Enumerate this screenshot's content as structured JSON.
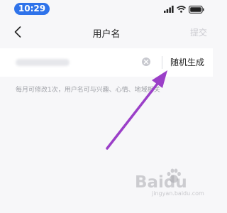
{
  "status_bar": {
    "time": "10:29",
    "icons": [
      "signal-icon",
      "wifi-icon",
      "battery-icon"
    ],
    "time_pill_color": "#2f73ea"
  },
  "nav": {
    "back_icon": "chevron-left-icon",
    "title": "用户名",
    "submit_label": "提交"
  },
  "form": {
    "username_value": "",
    "username_value_blurred": true,
    "clear_icon": "clear-icon",
    "random_label": "随机生成",
    "hint": "每月可修改1次，用户名可与兴趣、心情、地域相关"
  },
  "annotation": {
    "arrow_color": "#9b3fc8",
    "points_to": "random-generate-button"
  },
  "watermark": {
    "brand": "Baidu",
    "domain": "jingyan.baidu.com"
  }
}
